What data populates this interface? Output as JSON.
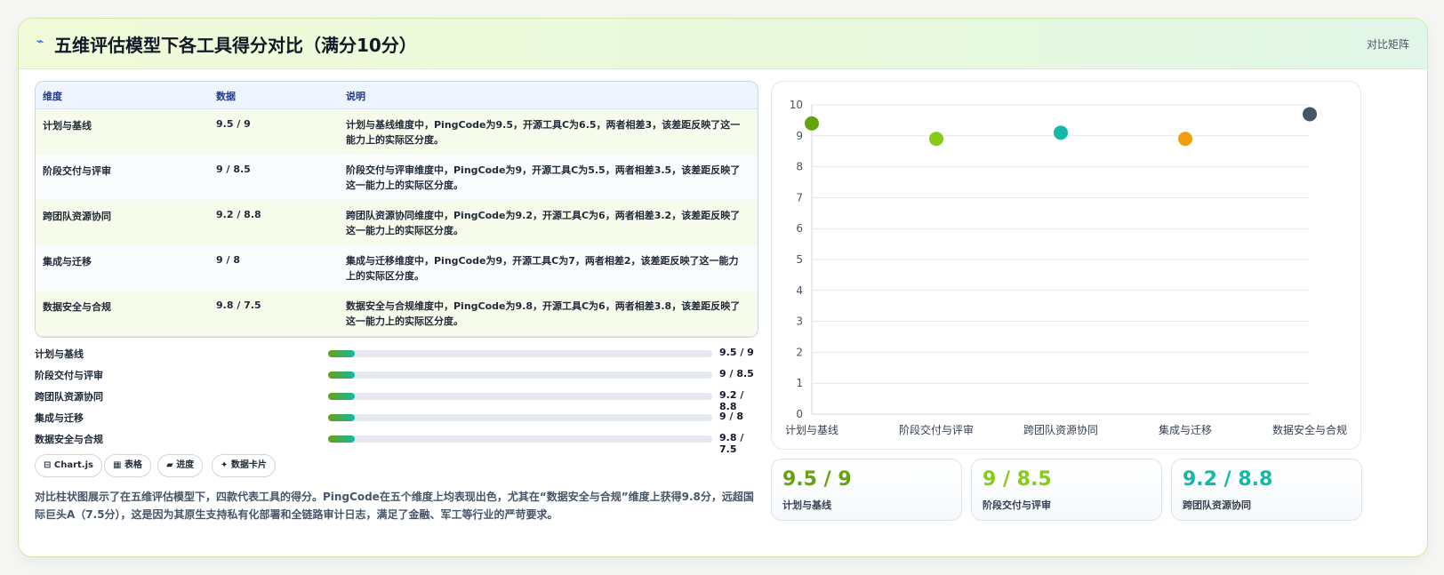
{
  "header": {
    "icon": "chart-spark-icon",
    "title": "五维评估模型下各工具得分对比（满分10分）",
    "tag": "对比矩阵"
  },
  "table": {
    "columns": [
      "维度",
      "数据",
      "说明"
    ],
    "rows": [
      {
        "dim": "计划与基线",
        "data": "9.5 / 9",
        "desc": "计划与基线维度中，PingCode为9.5，开源工具C为6.5，两者相差3，该差距反映了这一能力上的实际区分度。"
      },
      {
        "dim": "阶段交付与评审",
        "data": "9 / 8.5",
        "desc": "阶段交付与评审维度中，PingCode为9，开源工具C为5.5，两者相差3.5，该差距反映了这一能力上的实际区分度。"
      },
      {
        "dim": "跨团队资源协同",
        "data": "9.2 / 8.8",
        "desc": "跨团队资源协同维度中，PingCode为9.2，开源工具C为6，两者相差3.2，该差距反映了这一能力上的实际区分度。"
      },
      {
        "dim": "集成与迁移",
        "data": "9 / 8",
        "desc": "集成与迁移维度中，PingCode为9，开源工具C为7，两者相差2，该差距反映了这一能力上的实际区分度。"
      },
      {
        "dim": "数据安全与合规",
        "data": "9.8 / 7.5",
        "desc": "数据安全与合规维度中，PingCode为9.8，开源工具C为6，两者相差3.8，该差距反映了这一能力上的实际区分度。"
      }
    ]
  },
  "progress": [
    {
      "label": "计划与基线",
      "value": "9.5 / 9",
      "fill_pct": 7
    },
    {
      "label": "阶段交付与评审",
      "value": "9 / 8.5",
      "fill_pct": 7
    },
    {
      "label": "跨团队资源协同",
      "value": "9.2 / 8.8",
      "fill_pct": 7
    },
    {
      "label": "集成与迁移",
      "value": "9 / 8",
      "fill_pct": 7
    },
    {
      "label": "数据安全与合规",
      "value": "9.8 / 7.5",
      "fill_pct": 7
    }
  ],
  "chips": [
    {
      "icon": "grid-icon",
      "glyph": "⊟",
      "label": "Chart.js"
    },
    {
      "icon": "table-icon",
      "glyph": "▦",
      "label": "表格"
    },
    {
      "icon": "progress-icon",
      "glyph": "▰",
      "label": "进度"
    },
    {
      "icon": "sparkle-icon",
      "glyph": "✦",
      "label": "数据卡片"
    }
  ],
  "summary": "对比柱状图展示了在五维评估模型下，四款代表工具的得分。PingCode在五个维度上均表现出色，尤其在“数据安全与合规”维度上获得9.8分，远超国际巨头A（7.5分），这是因为其原生支持私有化部署和全链路审计日志，满足了金融、军工等行业的严苛要求。",
  "chart_data": {
    "type": "scatter",
    "categories": [
      "计划与基线",
      "阶段交付与评审",
      "跨团队资源协同",
      "集成与迁移",
      "数据安全与合规"
    ],
    "values": [
      9.4,
      8.9,
      9.1,
      8.9,
      9.7
    ],
    "point_colors": [
      "#65a30d",
      "#84cc16",
      "#14b8a6",
      "#f59e0b",
      "#475569"
    ],
    "ylim": [
      0,
      10
    ],
    "yticks": [
      "0",
      "1",
      "2",
      "3",
      "4",
      "5",
      "6",
      "7",
      "8",
      "9",
      "10"
    ],
    "grid": true
  },
  "stats": [
    {
      "value": "9.5 / 9",
      "label": "计划与基线",
      "color": "#65a30d"
    },
    {
      "value": "9 / 8.5",
      "label": "阶段交付与评审",
      "color": "#84cc16"
    },
    {
      "value": "9.2 / 8.8",
      "label": "跨团队资源协同",
      "color": "#14b8a6"
    }
  ]
}
